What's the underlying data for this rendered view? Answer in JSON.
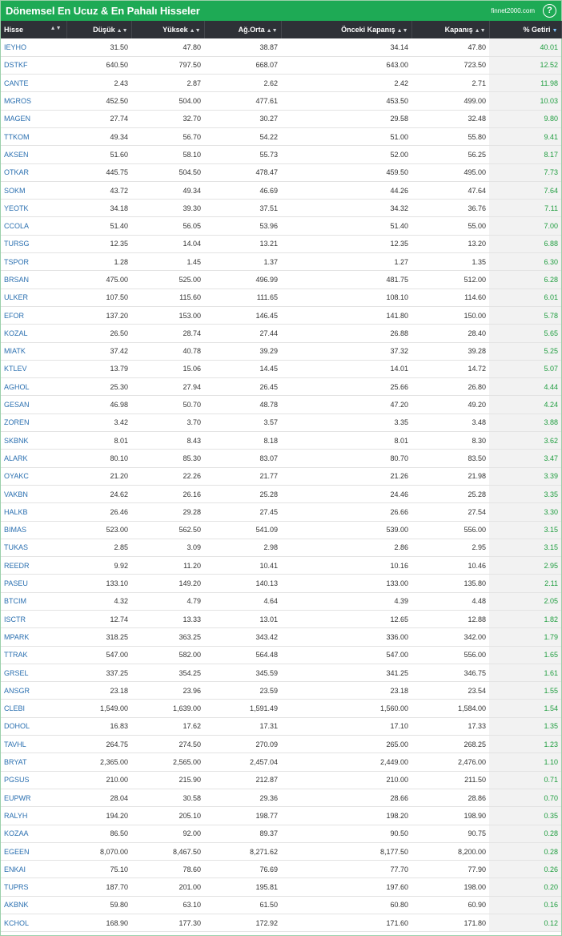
{
  "header": {
    "title": "Dönemsel En Ucuz & En Pahalı Hisseler",
    "brand": "finnet2000.com",
    "help_label": "?"
  },
  "table": {
    "columns": [
      "Hisse",
      "Düşük",
      "Yüksek",
      "Ağ.Orta",
      "Önceki Kapanış",
      "Kapanış",
      "% Getiri"
    ],
    "rows": [
      [
        "IEYHO",
        "31.50",
        "47.80",
        "38.87",
        "34.14",
        "47.80",
        "40.01"
      ],
      [
        "DSTKF",
        "640.50",
        "797.50",
        "668.07",
        "643.00",
        "723.50",
        "12.52"
      ],
      [
        "CANTE",
        "2.43",
        "2.87",
        "2.62",
        "2.42",
        "2.71",
        "11.98"
      ],
      [
        "MGROS",
        "452.50",
        "504.00",
        "477.61",
        "453.50",
        "499.00",
        "10.03"
      ],
      [
        "MAGEN",
        "27.74",
        "32.70",
        "30.27",
        "29.58",
        "32.48",
        "9.80"
      ],
      [
        "TTKOM",
        "49.34",
        "56.70",
        "54.22",
        "51.00",
        "55.80",
        "9.41"
      ],
      [
        "AKSEN",
        "51.60",
        "58.10",
        "55.73",
        "52.00",
        "56.25",
        "8.17"
      ],
      [
        "OTKAR",
        "445.75",
        "504.50",
        "478.47",
        "459.50",
        "495.00",
        "7.73"
      ],
      [
        "SOKM",
        "43.72",
        "49.34",
        "46.69",
        "44.26",
        "47.64",
        "7.64"
      ],
      [
        "YEOTK",
        "34.18",
        "39.30",
        "37.51",
        "34.32",
        "36.76",
        "7.11"
      ],
      [
        "CCOLA",
        "51.40",
        "56.05",
        "53.96",
        "51.40",
        "55.00",
        "7.00"
      ],
      [
        "TURSG",
        "12.35",
        "14.04",
        "13.21",
        "12.35",
        "13.20",
        "6.88"
      ],
      [
        "TSPOR",
        "1.28",
        "1.45",
        "1.37",
        "1.27",
        "1.35",
        "6.30"
      ],
      [
        "BRSAN",
        "475.00",
        "525.00",
        "496.99",
        "481.75",
        "512.00",
        "6.28"
      ],
      [
        "ULKER",
        "107.50",
        "115.60",
        "111.65",
        "108.10",
        "114.60",
        "6.01"
      ],
      [
        "EFOR",
        "137.20",
        "153.00",
        "146.45",
        "141.80",
        "150.00",
        "5.78"
      ],
      [
        "KOZAL",
        "26.50",
        "28.74",
        "27.44",
        "26.88",
        "28.40",
        "5.65"
      ],
      [
        "MIATK",
        "37.42",
        "40.78",
        "39.29",
        "37.32",
        "39.28",
        "5.25"
      ],
      [
        "KTLEV",
        "13.79",
        "15.06",
        "14.45",
        "14.01",
        "14.72",
        "5.07"
      ],
      [
        "AGHOL",
        "25.30",
        "27.94",
        "26.45",
        "25.66",
        "26.80",
        "4.44"
      ],
      [
        "GESAN",
        "46.98",
        "50.70",
        "48.78",
        "47.20",
        "49.20",
        "4.24"
      ],
      [
        "ZOREN",
        "3.42",
        "3.70",
        "3.57",
        "3.35",
        "3.48",
        "3.88"
      ],
      [
        "SKBNK",
        "8.01",
        "8.43",
        "8.18",
        "8.01",
        "8.30",
        "3.62"
      ],
      [
        "ALARK",
        "80.10",
        "85.30",
        "83.07",
        "80.70",
        "83.50",
        "3.47"
      ],
      [
        "OYAKC",
        "21.20",
        "22.26",
        "21.77",
        "21.26",
        "21.98",
        "3.39"
      ],
      [
        "VAKBN",
        "24.62",
        "26.16",
        "25.28",
        "24.46",
        "25.28",
        "3.35"
      ],
      [
        "HALKB",
        "26.46",
        "29.28",
        "27.45",
        "26.66",
        "27.54",
        "3.30"
      ],
      [
        "BIMAS",
        "523.00",
        "562.50",
        "541.09",
        "539.00",
        "556.00",
        "3.15"
      ],
      [
        "TUKAS",
        "2.85",
        "3.09",
        "2.98",
        "2.86",
        "2.95",
        "3.15"
      ],
      [
        "REEDR",
        "9.92",
        "11.20",
        "10.41",
        "10.16",
        "10.46",
        "2.95"
      ],
      [
        "PASEU",
        "133.10",
        "149.20",
        "140.13",
        "133.00",
        "135.80",
        "2.11"
      ],
      [
        "BTCIM",
        "4.32",
        "4.79",
        "4.64",
        "4.39",
        "4.48",
        "2.05"
      ],
      [
        "ISCTR",
        "12.74",
        "13.33",
        "13.01",
        "12.65",
        "12.88",
        "1.82"
      ],
      [
        "MPARK",
        "318.25",
        "363.25",
        "343.42",
        "336.00",
        "342.00",
        "1.79"
      ],
      [
        "TTRAK",
        "547.00",
        "582.00",
        "564.48",
        "547.00",
        "556.00",
        "1.65"
      ],
      [
        "GRSEL",
        "337.25",
        "354.25",
        "345.59",
        "341.25",
        "346.75",
        "1.61"
      ],
      [
        "ANSGR",
        "23.18",
        "23.96",
        "23.59",
        "23.18",
        "23.54",
        "1.55"
      ],
      [
        "CLEBI",
        "1,549.00",
        "1,639.00",
        "1,591.49",
        "1,560.00",
        "1,584.00",
        "1.54"
      ],
      [
        "DOHOL",
        "16.83",
        "17.62",
        "17.31",
        "17.10",
        "17.33",
        "1.35"
      ],
      [
        "TAVHL",
        "264.75",
        "274.50",
        "270.09",
        "265.00",
        "268.25",
        "1.23"
      ],
      [
        "BRYAT",
        "2,365.00",
        "2,565.00",
        "2,457.04",
        "2,449.00",
        "2,476.00",
        "1.10"
      ],
      [
        "PGSUS",
        "210.00",
        "215.90",
        "212.87",
        "210.00",
        "211.50",
        "0.71"
      ],
      [
        "EUPWR",
        "28.04",
        "30.58",
        "29.36",
        "28.66",
        "28.86",
        "0.70"
      ],
      [
        "RALYH",
        "194.20",
        "205.10",
        "198.77",
        "198.20",
        "198.90",
        "0.35"
      ],
      [
        "KOZAA",
        "86.50",
        "92.00",
        "89.37",
        "90.50",
        "90.75",
        "0.28"
      ],
      [
        "EGEEN",
        "8,070.00",
        "8,467.50",
        "8,271.62",
        "8,177.50",
        "8,200.00",
        "0.28"
      ],
      [
        "ENKAI",
        "75.10",
        "78.60",
        "76.69",
        "77.70",
        "77.90",
        "0.26"
      ],
      [
        "TUPRS",
        "187.70",
        "201.00",
        "195.81",
        "197.60",
        "198.00",
        "0.20"
      ],
      [
        "AKBNK",
        "59.80",
        "63.10",
        "61.50",
        "60.80",
        "60.90",
        "0.16"
      ],
      [
        "KCHOL",
        "168.90",
        "177.30",
        "172.92",
        "171.60",
        "171.80",
        "0.12"
      ]
    ]
  },
  "colors": {
    "header_bg": "#1eaa55",
    "table_head_bg": "#2e3137",
    "symbol_link": "#2a6fb0",
    "gain_text": "#1f9d3f"
  }
}
